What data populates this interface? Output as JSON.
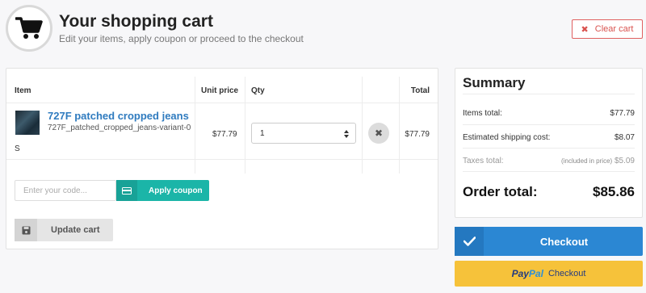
{
  "header": {
    "title": "Your shopping cart",
    "subtitle": "Edit your items, apply coupon or proceed to the checkout",
    "clear_label": "Clear cart"
  },
  "table": {
    "columns": [
      "Item",
      "Unit price",
      "Qty",
      "Total"
    ],
    "rows": [
      {
        "name": "727F patched cropped jeans",
        "variant": "727F_patched_cropped_jeans-variant-0",
        "variant_suffix": "S",
        "unit_price": "$77.79",
        "qty": "1",
        "total": "$77.79"
      }
    ]
  },
  "coupon": {
    "placeholder": "Enter your code...",
    "apply_label": "Apply coupon"
  },
  "update_label": "Update cart",
  "summary": {
    "title": "Summary",
    "items_label": "Items total:",
    "items_value": "$77.79",
    "shipping_label": "Estimated shipping cost:",
    "shipping_value": "$8.07",
    "taxes_label": "Taxes total:",
    "taxes_note": "(included in price)",
    "taxes_value": "$5.09",
    "order_label": "Order total:",
    "order_value": "$85.86"
  },
  "checkout_label": "Checkout",
  "paypal": {
    "logo_pay": "Pay",
    "logo_pal": "Pal",
    "label": "Checkout"
  },
  "colors": {
    "accent": "#2b87d3",
    "coupon": "#1bb5a8",
    "paypal": "#f6c23a",
    "danger": "#d9534f",
    "link": "#2f7bbf"
  }
}
